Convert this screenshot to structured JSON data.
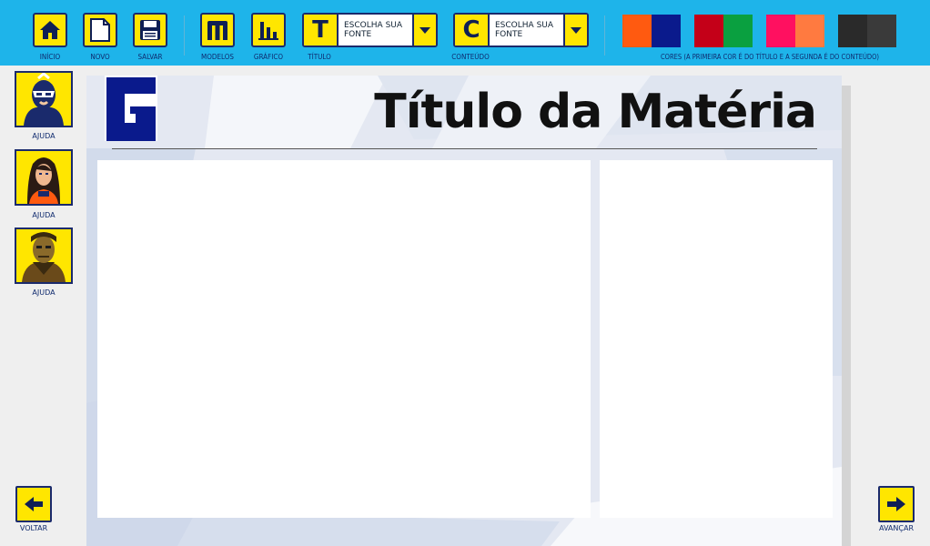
{
  "toolbar": {
    "home_label": "INÍCIO",
    "new_label": "NOVO",
    "save_label": "SALVAR",
    "models_label": "MODELOS",
    "chart_label": "GRÁFICO",
    "title_font": {
      "letter": "T",
      "value": "ESCOLHA SUA FONTE",
      "label": "TÍTULO"
    },
    "content_font": {
      "letter": "C",
      "value": "ESCOLHA SUA FONTE",
      "label": "CONTEÚDO"
    },
    "colors_label": "CORES (A PRIMEIRA COR É DO TÍTULO E A SEGUNDA É DO CONTEÚDO)",
    "color_pairs": [
      {
        "first": "#ff5a10",
        "second": "#0a1a8c"
      },
      {
        "first": "#c40018",
        "second": "#0aa040"
      },
      {
        "first": "#ff1060",
        "second": "#ff7a40"
      },
      {
        "first": "#2a2a2a",
        "second": "#3a3a3a"
      }
    ]
  },
  "sidebar": {
    "help_items": [
      {
        "label": "AJUDA",
        "icon": "hero-avatar-icon"
      },
      {
        "label": "AJUDA",
        "icon": "heroine-avatar-icon"
      },
      {
        "label": "AJUDA",
        "icon": "villain-avatar-icon"
      }
    ]
  },
  "page": {
    "title": "Título da Matéria",
    "logo_letter": "G"
  },
  "nav": {
    "back_label": "VOLTAR",
    "next_label": "AVANÇAR"
  }
}
